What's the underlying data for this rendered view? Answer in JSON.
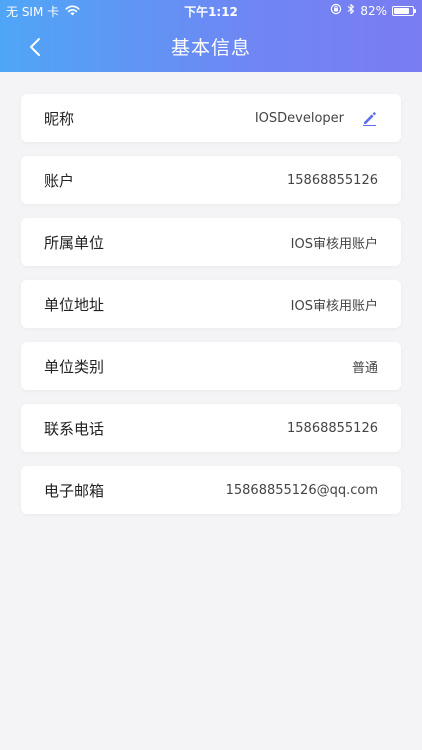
{
  "status_bar": {
    "carrier": "无 SIM 卡",
    "time": "下午1:12",
    "battery_text": "82%",
    "battery_level": 0.82
  },
  "nav": {
    "title": "基本信息"
  },
  "rows": [
    {
      "label": "昵称",
      "value": "IOSDeveloper"
    },
    {
      "label": "账户",
      "value": "15868855126"
    },
    {
      "label": "所属单位",
      "value": "IOS审核用账户"
    },
    {
      "label": "单位地址",
      "value": "IOS审核用账户"
    },
    {
      "label": "单位类别",
      "value": "普通"
    },
    {
      "label": "联系电话",
      "value": "15868855126"
    },
    {
      "label": "电子邮箱",
      "value": "15868855126@qq.com"
    }
  ],
  "colors": {
    "header_gradient_start": "#4fa6f7",
    "header_gradient_end": "#7a7cf2",
    "edit_icon": "#5b6cf0"
  },
  "icons": {
    "back": "chevron-left-icon",
    "edit": "pencil-icon",
    "wifi": "wifi-icon",
    "bluetooth": "bluetooth-icon",
    "orientation_lock": "orientation-lock-icon"
  }
}
